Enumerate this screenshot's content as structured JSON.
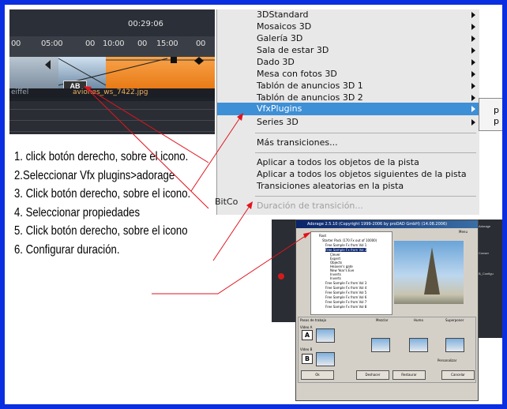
{
  "timeline": {
    "time_display": "00:29:06",
    "ticks": [
      "00",
      "05:00",
      "00",
      "10:00",
      "00",
      "15:00",
      "00"
    ],
    "clip_left_label": "eiffel",
    "clip_ab_badge": "AB",
    "clip_name": "aviones_ws_7422.jpg"
  },
  "menu": {
    "items": [
      {
        "label": "3DStandard",
        "submenu": true
      },
      {
        "label": "Mosaicos 3D",
        "submenu": true
      },
      {
        "label": "Galería 3D",
        "submenu": true
      },
      {
        "label": "Sala de estar 3D",
        "submenu": true
      },
      {
        "label": "Dado 3D",
        "submenu": true
      },
      {
        "label": "Mesa con fotos 3D",
        "submenu": true
      },
      {
        "label": "Tablón de anuncios 3D 1",
        "submenu": true
      },
      {
        "label": "Tablón de anuncios 3D 2",
        "submenu": true
      },
      {
        "label": "VfxPlugins",
        "submenu": true,
        "selected": true
      },
      {
        "label": "Series 3D",
        "submenu": true
      }
    ],
    "more": "Más transiciones...",
    "apply_group": [
      "Aplicar a todos los objetos de la pista",
      "Aplicar a todos los objetos siguientes de la pista",
      "Transiciones aleatorias en la pista"
    ],
    "disabled_item": "Duración de transición...",
    "submenu_items": [
      "p",
      "p"
    ],
    "background_text": "BitCo"
  },
  "steps": [
    "1. click botón derecho, sobre el icono.",
    "2.Seleccionar Vfx plugins>adorage",
    "3. Click botón derecho, sobre el icono.",
    "4. Seleccionar propiedades",
    "5. Click botón derecho, sobre el icono",
    "6. Configurar duración."
  ],
  "dialog": {
    "title": "Adorage 2.5.10 (Copyright 1999-2006 by proDAD GmbH) (14.08.2006)",
    "tree_root": "Root",
    "tree_items": [
      "Starter Pack (170 Fx out of 10000)",
      "Free Sample Fx from Vol 1",
      "Free Sample Fx from Vol 2",
      "Clever",
      "Expert",
      "Objects",
      "Heaven's gate",
      "New Year's Eve",
      "Inverts",
      "Inverts",
      "Free Sample Fx from Vol 3",
      "Free Sample Fx from Vol 4",
      "Free Sample Fx from Vol 5",
      "Free Sample Fx from Vol 6",
      "Free Sample Fx from Vol 7",
      "Free Sample Fx from Vol 8"
    ],
    "steps_label": "Pasos de trabajo",
    "video_a": "Vídeo A",
    "video_b": "Vídeo B",
    "letter_a": "A",
    "letter_b": "B",
    "col_mezcla": "Mezclar",
    "col_humo": "Humo",
    "col_superponer": "Superponer",
    "personalize": "Personalizar",
    "btn_ok": "Ok",
    "btn_undo": "Deshacer",
    "btn_restore": "Restaurar",
    "btn_cancel": "Cancelar",
    "menu_label": "Menu",
    "side_text_1": "Adorage",
    "side_text_2": "Conser",
    "side_text_3": "B_Configu"
  },
  "colors": {
    "frame_border": "#0a2fe0",
    "menu_highlight": "#3d8fd6",
    "arrow_line": "#e0141e"
  }
}
